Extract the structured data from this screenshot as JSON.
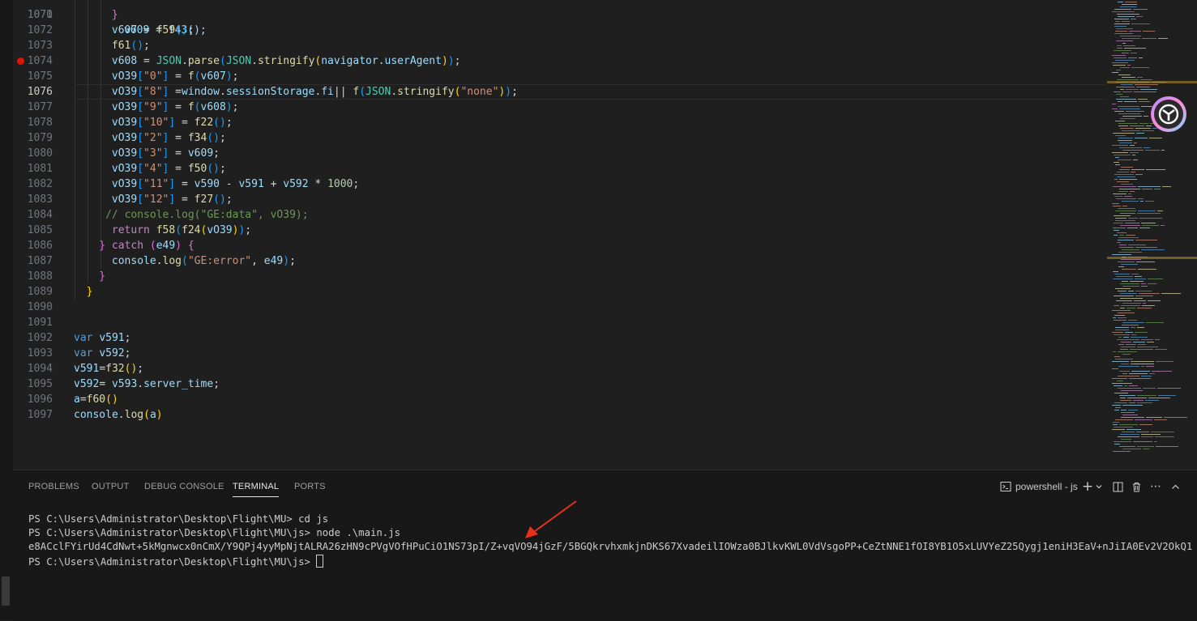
{
  "editor": {
    "active_line": "1076",
    "breakpoint_line": "1074",
    "line_numbers": [
      "1071",
      "1072",
      "1073",
      "1074",
      "1075",
      "1076",
      "1077",
      "1078",
      "1079",
      "1080",
      "1081",
      "1082",
      "1083",
      "1084",
      "1085",
      "1086",
      "1087",
      "1088",
      "1089",
      "1090",
      "1091",
      "1092",
      "1093",
      "1094",
      "1095",
      "1096",
      "1097"
    ],
    "top_partial": {
      "number": "1070",
      "text": "v609 = f43();"
    },
    "lines": [
      [
        [
          "br2",
          "}"
        ]
      ],
      [
        [
          "var",
          "v607"
        ],
        [
          "pl",
          " = "
        ],
        [
          "fn",
          "f59"
        ],
        [
          "br3",
          "()"
        ],
        [
          "pl",
          ";"
        ]
      ],
      [
        [
          "fn",
          "f61"
        ],
        [
          "br3",
          "()"
        ],
        [
          "pl",
          ";"
        ]
      ],
      [
        [
          "var",
          "v608"
        ],
        [
          "pl",
          " = "
        ],
        [
          "cls",
          "JSON"
        ],
        [
          "pl",
          "."
        ],
        [
          "fn",
          "parse"
        ],
        [
          "br3",
          "("
        ],
        [
          "cls",
          "JSON"
        ],
        [
          "pl",
          "."
        ],
        [
          "fn",
          "stringify"
        ],
        [
          "br1",
          "("
        ],
        [
          "var",
          "navigator"
        ],
        [
          "pl",
          "."
        ],
        [
          "var",
          "userAgent"
        ],
        [
          "br1",
          ")"
        ],
        [
          "br3",
          ")"
        ],
        [
          "pl",
          ";"
        ]
      ],
      [
        [
          "var",
          "vO39"
        ],
        [
          "br3",
          "["
        ],
        [
          "str",
          "\"0\""
        ],
        [
          "br3",
          "]"
        ],
        [
          "pl",
          " = "
        ],
        [
          "fn",
          "f"
        ],
        [
          "br3",
          "("
        ],
        [
          "var",
          "v607"
        ],
        [
          "br3",
          ")"
        ],
        [
          "pl",
          ";"
        ]
      ],
      [
        [
          "var",
          "vO39"
        ],
        [
          "br3",
          "["
        ],
        [
          "str",
          "\"8\""
        ],
        [
          "br3",
          "]"
        ],
        [
          "pl",
          " ="
        ],
        [
          "var",
          "window"
        ],
        [
          "pl",
          "."
        ],
        [
          "var",
          "sessionStorage"
        ],
        [
          "pl",
          "."
        ],
        [
          "var",
          "fi"
        ],
        [
          "pl",
          "|| "
        ],
        [
          "fn",
          "f"
        ],
        [
          "br3",
          "("
        ],
        [
          "cls",
          "JSON"
        ],
        [
          "pl",
          "."
        ],
        [
          "fn",
          "stringify"
        ],
        [
          "br1",
          "("
        ],
        [
          "str",
          "\"none\""
        ],
        [
          "br1",
          ")"
        ],
        [
          "br3",
          ")"
        ],
        [
          "pl",
          ";"
        ]
      ],
      [
        [
          "var",
          "vO39"
        ],
        [
          "br3",
          "["
        ],
        [
          "str",
          "\"9\""
        ],
        [
          "br3",
          "]"
        ],
        [
          "pl",
          " = "
        ],
        [
          "fn",
          "f"
        ],
        [
          "br3",
          "("
        ],
        [
          "var",
          "v608"
        ],
        [
          "br3",
          ")"
        ],
        [
          "pl",
          ";"
        ]
      ],
      [
        [
          "var",
          "vO39"
        ],
        [
          "br3",
          "["
        ],
        [
          "str",
          "\"10\""
        ],
        [
          "br3",
          "]"
        ],
        [
          "pl",
          " = "
        ],
        [
          "fn",
          "f22"
        ],
        [
          "br3",
          "()"
        ],
        [
          "pl",
          ";"
        ]
      ],
      [
        [
          "var",
          "vO39"
        ],
        [
          "br3",
          "["
        ],
        [
          "str",
          "\"2\""
        ],
        [
          "br3",
          "]"
        ],
        [
          "pl",
          " = "
        ],
        [
          "fn",
          "f34"
        ],
        [
          "br3",
          "()"
        ],
        [
          "pl",
          ";"
        ]
      ],
      [
        [
          "var",
          "vO39"
        ],
        [
          "br3",
          "["
        ],
        [
          "str",
          "\"3\""
        ],
        [
          "br3",
          "]"
        ],
        [
          "pl",
          " = "
        ],
        [
          "var",
          "v609"
        ],
        [
          "pl",
          ";"
        ]
      ],
      [
        [
          "var",
          "vO39"
        ],
        [
          "br3",
          "["
        ],
        [
          "str",
          "\"4\""
        ],
        [
          "br3",
          "]"
        ],
        [
          "pl",
          " = "
        ],
        [
          "fn",
          "f50"
        ],
        [
          "br3",
          "()"
        ],
        [
          "pl",
          ";"
        ]
      ],
      [
        [
          "var",
          "vO39"
        ],
        [
          "br3",
          "["
        ],
        [
          "str",
          "\"11\""
        ],
        [
          "br3",
          "]"
        ],
        [
          "pl",
          " = "
        ],
        [
          "var",
          "v590"
        ],
        [
          "pl",
          " - "
        ],
        [
          "var",
          "v591"
        ],
        [
          "pl",
          " + "
        ],
        [
          "var",
          "v592"
        ],
        [
          "pl",
          " * "
        ],
        [
          "num",
          "1000"
        ],
        [
          "pl",
          ";"
        ]
      ],
      [
        [
          "var",
          "vO39"
        ],
        [
          "br3",
          "["
        ],
        [
          "str",
          "\"12\""
        ],
        [
          "br3",
          "]"
        ],
        [
          "pl",
          " = "
        ],
        [
          "fn",
          "f27"
        ],
        [
          "br3",
          "()"
        ],
        [
          "pl",
          ";"
        ]
      ],
      [
        [
          "cmt",
          "// console.log(\"GE:data\", vO39);"
        ]
      ],
      [
        [
          "ctl",
          "return "
        ],
        [
          "fn",
          "f58"
        ],
        [
          "br3",
          "("
        ],
        [
          "fn",
          "f24"
        ],
        [
          "br1",
          "("
        ],
        [
          "var",
          "vO39"
        ],
        [
          "br1",
          ")"
        ],
        [
          "br3",
          ")"
        ],
        [
          "pl",
          ";"
        ]
      ],
      [
        [
          "br2",
          "} "
        ],
        [
          "ctl",
          "catch "
        ],
        [
          "br2",
          "("
        ],
        [
          "var",
          "e49"
        ],
        [
          "br2",
          ")"
        ],
        [
          "pl",
          " "
        ],
        [
          "br2",
          "{"
        ]
      ],
      [
        [
          "var",
          "console"
        ],
        [
          "pl",
          "."
        ],
        [
          "fn",
          "log"
        ],
        [
          "br3",
          "("
        ],
        [
          "str",
          "\"GE:error\""
        ],
        [
          "pl",
          ", "
        ],
        [
          "var",
          "e49"
        ],
        [
          "br3",
          ")"
        ],
        [
          "pl",
          ";"
        ]
      ],
      [
        [
          "br2",
          "}"
        ]
      ],
      [
        [
          "br1",
          "}"
        ]
      ],
      [],
      [],
      [
        [
          "kw",
          "var "
        ],
        [
          "var",
          "v591"
        ],
        [
          "pl",
          ";"
        ]
      ],
      [
        [
          "kw",
          "var "
        ],
        [
          "var",
          "v592"
        ],
        [
          "pl",
          ";"
        ]
      ],
      [
        [
          "var",
          "v591"
        ],
        [
          "pl",
          "="
        ],
        [
          "fn",
          "f32"
        ],
        [
          "br1",
          "()"
        ],
        [
          "pl",
          ";"
        ]
      ],
      [
        [
          "var",
          "v592"
        ],
        [
          "pl",
          "= "
        ],
        [
          "var",
          "v593"
        ],
        [
          "pl",
          "."
        ],
        [
          "var",
          "server_time"
        ],
        [
          "pl",
          ";"
        ]
      ],
      [
        [
          "var",
          "a"
        ],
        [
          "pl",
          "="
        ],
        [
          "fn",
          "f60"
        ],
        [
          "br1",
          "()"
        ]
      ],
      [
        [
          "var",
          "console"
        ],
        [
          "pl",
          "."
        ],
        [
          "fn",
          "log"
        ],
        [
          "br1",
          "("
        ],
        [
          "var",
          "a"
        ],
        [
          "br1",
          ")"
        ]
      ]
    ],
    "indent_levels": [
      6,
      6,
      6,
      6,
      6,
      6,
      6,
      6,
      6,
      6,
      6,
      6,
      6,
      5,
      6,
      4,
      6,
      4,
      2,
      0,
      0,
      0,
      0,
      0,
      0,
      0,
      0
    ]
  },
  "panel": {
    "tabs": [
      "PROBLEMS",
      "OUTPUT",
      "DEBUG CONSOLE",
      "TERMINAL",
      "PORTS"
    ],
    "active_tab": "TERMINAL",
    "terminal_profile": "powershell - js",
    "terminal_lines": [
      "PS C:\\Users\\Administrator\\Desktop\\Flight\\MU> cd js",
      "PS C:\\Users\\Administrator\\Desktop\\Flight\\MU\\js> node .\\main.js",
      "e8ACclFYirUd4CdNwt+5kMgnwcx0nCmX/Y9QPj4yyMpNjtALRA26zHN9cPVgVOfHPuCiO1NS73pI/Z+vqVO94jGzF/5BGQkrvhxmkjnDKS67XvadeilIOWza0BJlkvKWL0VdVsgoPP+CeZtNNE1fOI8YB1O5xLUVYeZ25Qygj1eniH3EaV+nJiIA0Ev2V2OkQ1",
      "PS C:\\Users\\Administrator\\Desktop\\Flight\\MU\\js> "
    ]
  },
  "colors": {
    "editor_bg": "#1f1f1f",
    "panel_bg": "#181818",
    "breakpoint": "#e51400",
    "annotation_arrow": "#e8301c"
  },
  "icons": [
    "terminal-icon",
    "plus-icon",
    "chevron-down-icon",
    "split-terminal-icon",
    "trash-icon",
    "more-icon",
    "maximize-panel-icon"
  ]
}
